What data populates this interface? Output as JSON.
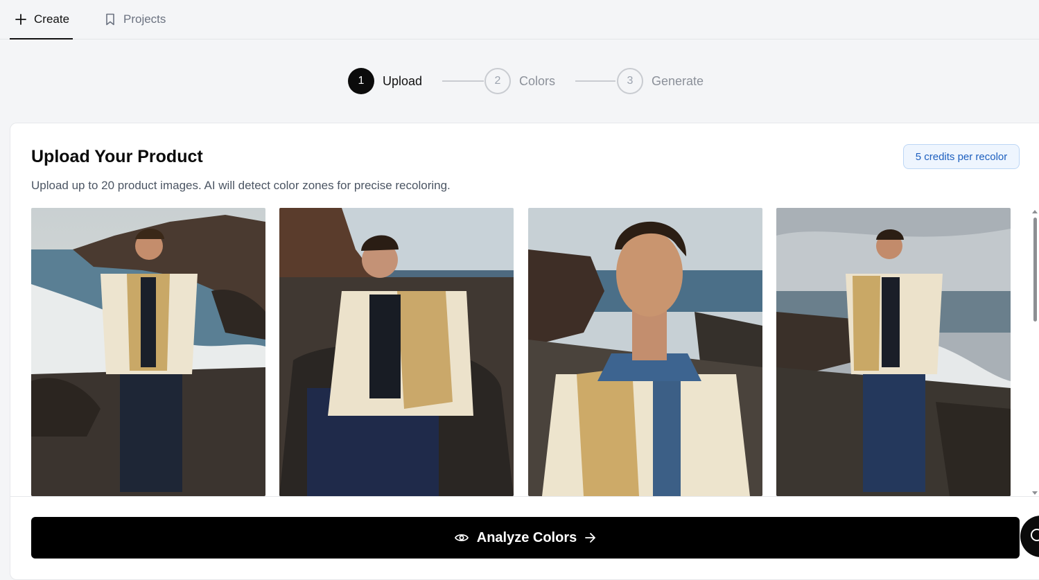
{
  "nav": {
    "tabs": [
      {
        "label": "Create",
        "icon": "plus-icon",
        "active": true
      },
      {
        "label": "Projects",
        "icon": "bookmark-icon",
        "active": false
      }
    ]
  },
  "stepper": {
    "steps": [
      {
        "number": "1",
        "label": "Upload",
        "state": "active"
      },
      {
        "number": "2",
        "label": "Colors",
        "state": "pending"
      },
      {
        "number": "3",
        "label": "Generate",
        "state": "pending"
      }
    ]
  },
  "upload": {
    "title": "Upload Your Product",
    "description": "Upload up to 20 product images. AI will detect color zones for precise recoloring.",
    "credits_badge": "5 credits per recolor"
  },
  "gallery": {
    "images": [
      {
        "alt": "Model standing on black sand beach in cream jacket"
      },
      {
        "alt": "Model sitting on volcanic rock in cream jacket"
      },
      {
        "alt": "Close-up of model wearing cream jacket with denim collar"
      },
      {
        "alt": "Model standing on rocky coast in cream jacket"
      }
    ]
  },
  "actions": {
    "analyze_label": "Analyze Colors",
    "analyze_icon": "eye-icon",
    "analyze_trailing_icon": "arrow-right-icon"
  },
  "colors": {
    "accent": "#000000",
    "badge_text": "#1d5fbf",
    "badge_bg": "#eef5fe",
    "page_bg": "#f4f5f7"
  }
}
